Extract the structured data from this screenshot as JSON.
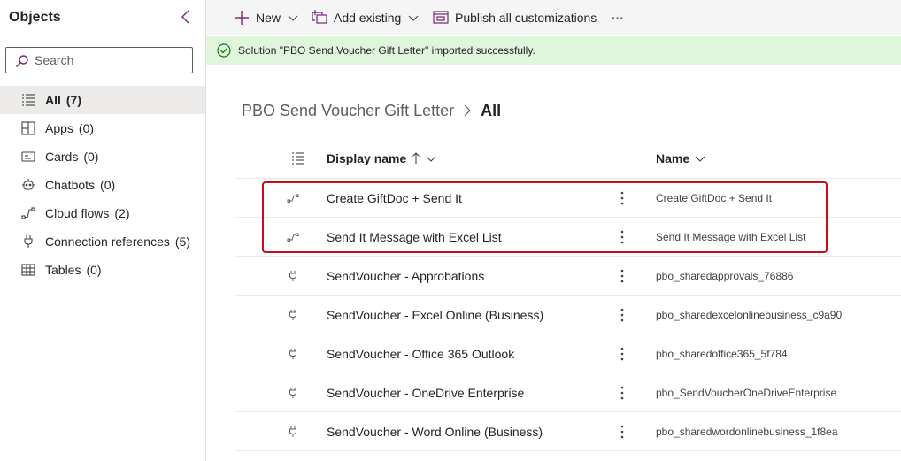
{
  "sidebar": {
    "title": "Objects",
    "search": {
      "placeholder": "Search"
    },
    "items": [
      {
        "label": "All",
        "count": "(7)",
        "icon": "list-icon",
        "active": true
      },
      {
        "label": "Apps",
        "count": "(0)",
        "icon": "apps-icon"
      },
      {
        "label": "Cards",
        "count": "(0)",
        "icon": "card-icon"
      },
      {
        "label": "Chatbots",
        "count": "(0)",
        "icon": "bot-icon"
      },
      {
        "label": "Cloud flows",
        "count": "(2)",
        "icon": "flow-icon"
      },
      {
        "label": "Connection references",
        "count": "(5)",
        "icon": "plug-icon"
      },
      {
        "label": "Tables",
        "count": "(0)",
        "icon": "table-icon"
      }
    ]
  },
  "toolbar": {
    "new_label": "New",
    "add_existing_label": "Add existing",
    "publish_label": "Publish all customizations",
    "more_label": "···"
  },
  "banner": {
    "message": "Solution \"PBO Send Voucher Gift Letter\" imported successfully.",
    "icon": "check-circle-icon",
    "color": "#107c10"
  },
  "breadcrumb": {
    "parent": "PBO Send Voucher Gift Letter",
    "current": "All"
  },
  "grid": {
    "columns": {
      "display_name": "Display name",
      "name": "Name"
    },
    "rows": [
      {
        "display": "Create GiftDoc + Send It",
        "name": "Create GiftDoc + Send It",
        "icon": "flow-icon"
      },
      {
        "display": "Send It Message with Excel List",
        "name": "Send It Message with Excel List",
        "icon": "flow-icon"
      },
      {
        "display": "SendVoucher - Approbations",
        "name": "pbo_sharedapprovals_76886",
        "icon": "plug-icon"
      },
      {
        "display": "SendVoucher - Excel Online (Business)",
        "name": "pbo_sharedexcelonlinebusiness_c9a90",
        "icon": "plug-icon"
      },
      {
        "display": "SendVoucher - Office 365 Outlook",
        "name": "pbo_sharedoffice365_5f784",
        "icon": "plug-icon"
      },
      {
        "display": "SendVoucher - OneDrive Enterprise",
        "name": "pbo_SendVoucherOneDriveEnterprise",
        "icon": "plug-icon"
      },
      {
        "display": "SendVoucher - Word Online (Business)",
        "name": "pbo_sharedwordonlinebusiness_1f8ea",
        "icon": "plug-icon"
      }
    ]
  },
  "colors": {
    "accent": "#742774",
    "highlight": "#c50f1f",
    "banner_bg": "#dff6dd"
  }
}
